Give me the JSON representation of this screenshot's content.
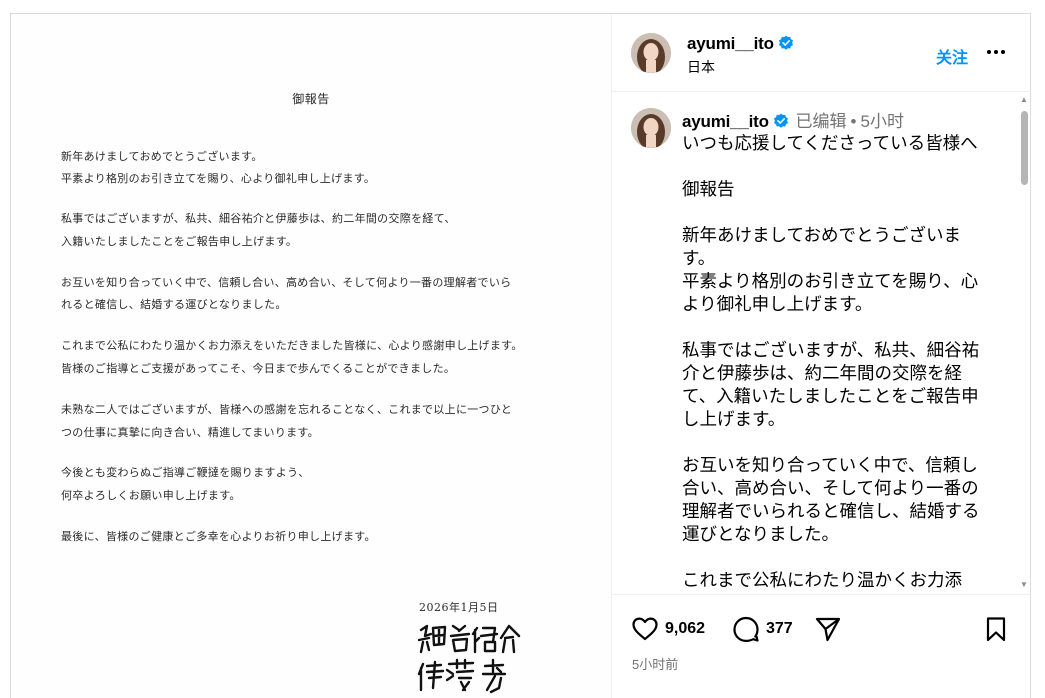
{
  "letter": {
    "title": "御報告",
    "lines": [
      "新年あけましておめでとうございます。",
      "平素より格別のお引き立てを賜り、心より御礼申し上げます。",
      "私事ではございますが、私共、細谷祐介と伊藤歩は、約二年間の交際を経て、",
      "入籍いたしましたことをご報告申し上げます。",
      "お互いを知り合っていく中で、信頼し合い、高め合い、そして何より一番の理解者でいら",
      "れると確信し、結婚する運びとなりました。",
      "これまで公私にわたり温かくお力添えをいただきました皆様に、心より感謝申し上げます。",
      "皆様のご指導とご支援があってこそ、今日まで歩んでくることができました。",
      "未熟な二人ではございますが、皆様への感謝を忘れることなく、これまで以上に一つひと",
      "つの仕事に真摯に向き合い、精進してまいります。",
      "今後とも変わらぬご指導ご鞭撻を賜りますよう、",
      "何卒よろしくお願い申し上げます。",
      "最後に、皆様のご健康とご多幸を心よりお祈り申し上げます。"
    ],
    "date": "2026年1月5日",
    "signature_names": [
      "細谷 祐介",
      "伊藤 歩"
    ]
  },
  "header": {
    "username": "ayumi__ito",
    "location": "日本",
    "follow_label": "关注",
    "more_icon": "more-horizontal-icon",
    "verified_color": "#0095f6"
  },
  "caption": {
    "username": "ayumi__ito",
    "edited_label": "已编辑",
    "separator": "•",
    "time": "5小时",
    "text": "いつも応援してくださっている皆様へ\n\n御報告\n\n新年あけましておめでとうございます。\n平素より格別のお引き立てを賜り、心より御礼申し上げます。\n\n私事ではございますが、私共、細谷祐介と伊藤歩は、約二年間の交際を経て、入籍いたしましたことをご報告申し上げます。\n\nお互いを知り合っていく中で、信頼し合い、高め合い、そして何より一番の理解者でいられると確信し、結婚する運びとなりました。\n\nこれまで公私にわたり温かくお力添"
  },
  "actions": {
    "likes": "9,062",
    "comments": "377",
    "posted_ago": "5小时前"
  },
  "colors": {
    "accent": "#0095f6",
    "muted": "#737373",
    "border": "#dbdbdb"
  }
}
